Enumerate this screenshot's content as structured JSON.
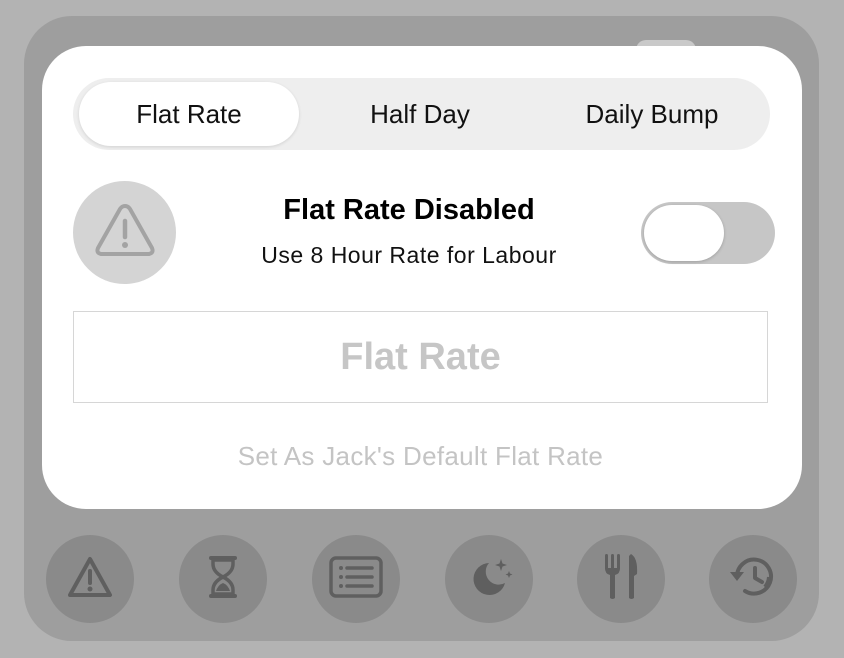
{
  "tabs": [
    {
      "label": "Flat Rate",
      "selected": true
    },
    {
      "label": "Half Day",
      "selected": false
    },
    {
      "label": "Daily Bump",
      "selected": false
    }
  ],
  "status": {
    "icon": "warning-triangle-icon",
    "title": "Flat Rate Disabled",
    "subtitle": "Use 8 Hour Rate for Labour",
    "toggle_on": false
  },
  "rate_field": {
    "value": "",
    "placeholder": "Flat Rate"
  },
  "default_link": "Set As Jack's Default Flat Rate",
  "bottom_bar": [
    {
      "icon": "warning-triangle-icon"
    },
    {
      "icon": "hourglass-icon"
    },
    {
      "icon": "list-document-icon"
    },
    {
      "icon": "moon-stars-icon"
    },
    {
      "icon": "fork-knife-icon"
    },
    {
      "icon": "history-clock-icon"
    }
  ],
  "colors": {
    "background": "#b3b3b3",
    "modal": "#ffffff",
    "segment_track": "#eeeeee",
    "toggle_off": "#c6c6c6",
    "muted_text": "#c4c4c4"
  }
}
